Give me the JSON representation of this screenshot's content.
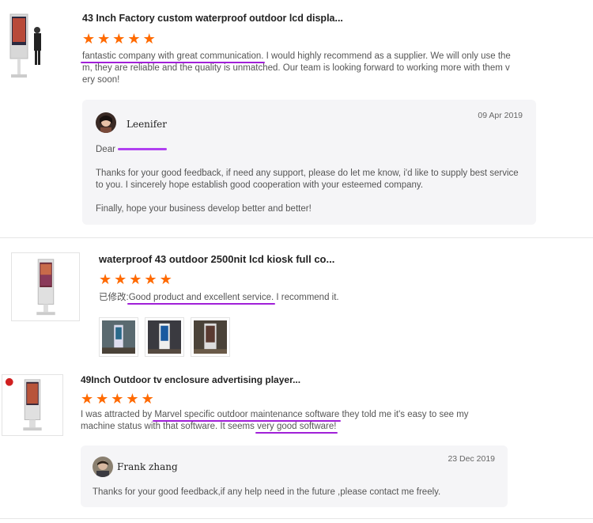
{
  "reviews": [
    {
      "title": "43 Inch Factory custom waterproof outdoor lcd displa...",
      "rating": 5,
      "text_highlight": "fantastic company with great communication.",
      "text_rest": " I would highly recommend as a supplier. We will only use the m, they are reliable and the quality is unmatched. Our team is looking forward to working more with them v ery soon!",
      "reply": {
        "author": "Leenifer",
        "date": "09 Apr 2019",
        "greeting": "Dear",
        "para1": "Thanks for your good feedback, if need any support, please do let me know, i'd like to supply best service to you. I sincerely hope establish good cooperation with your esteemed company.",
        "para2": "Finally, hope your business develop better and better!"
      }
    },
    {
      "title": "waterproof 43 outdoor 2500nit lcd kiosk full co...",
      "rating": 5,
      "prefix": "已修改:",
      "text_highlight": "Good product and excellent service.",
      "text_rest": " I recommend it."
    },
    {
      "title": "49Inch Outdoor tv enclosure advertising player...",
      "rating": 5,
      "text_a": "I was attracted by ",
      "text_highlight": "Marvel specific outdoor maintenance software",
      "text_b": " they told me it's easy to see my machine status with that software. It seems ",
      "text_highlight2": "very good software!",
      "reply": {
        "author": "Frank zhang",
        "date": "23 Dec 2019",
        "para1": "Thanks for your good feedback,if any help  need in the future ,please contact me freely."
      }
    }
  ],
  "colors": {
    "star": "#ff6a00",
    "highlight_underline": "#a020d8"
  }
}
